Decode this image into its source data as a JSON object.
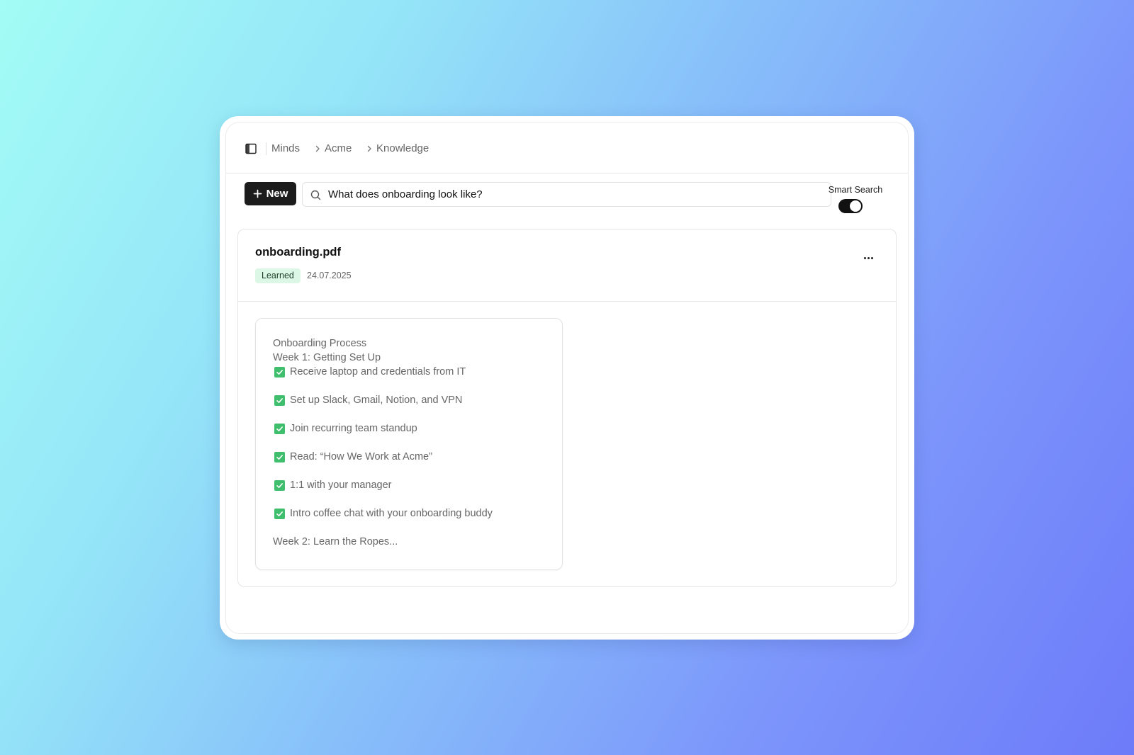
{
  "breadcrumb": [
    "Minds",
    "Acme",
    "Knowledge"
  ],
  "toolbar": {
    "new_label": "New",
    "search_value": "What does onboarding look like?",
    "smart_search_label": "Smart Search",
    "smart_search_on": true
  },
  "document": {
    "filename": "onboarding.pdf",
    "status": "Learned",
    "date": "24.07.2025",
    "preview": {
      "title": "Onboarding Process",
      "section": "Week 1: Getting Set Up",
      "checklist": [
        "Receive laptop and credentials from IT",
        "Set up Slack, Gmail, Notion, and VPN",
        "Join recurring team standup",
        "Read: “How We Work at Acme”",
        "1:1 with your manager",
        "Intro coffee chat with your onboarding buddy"
      ],
      "next_section": "Week 2: Learn the Ropes..."
    }
  },
  "colors": {
    "accent_dark": "#1c1c1c",
    "badge_bg": "#dcf7e6",
    "check_green": "#3fbf6e"
  },
  "icons": [
    "sidebar-toggle-icon",
    "chevron-right-icon",
    "plus-icon",
    "search-icon",
    "more-horizontal-icon",
    "checkbox-checked-icon"
  ]
}
